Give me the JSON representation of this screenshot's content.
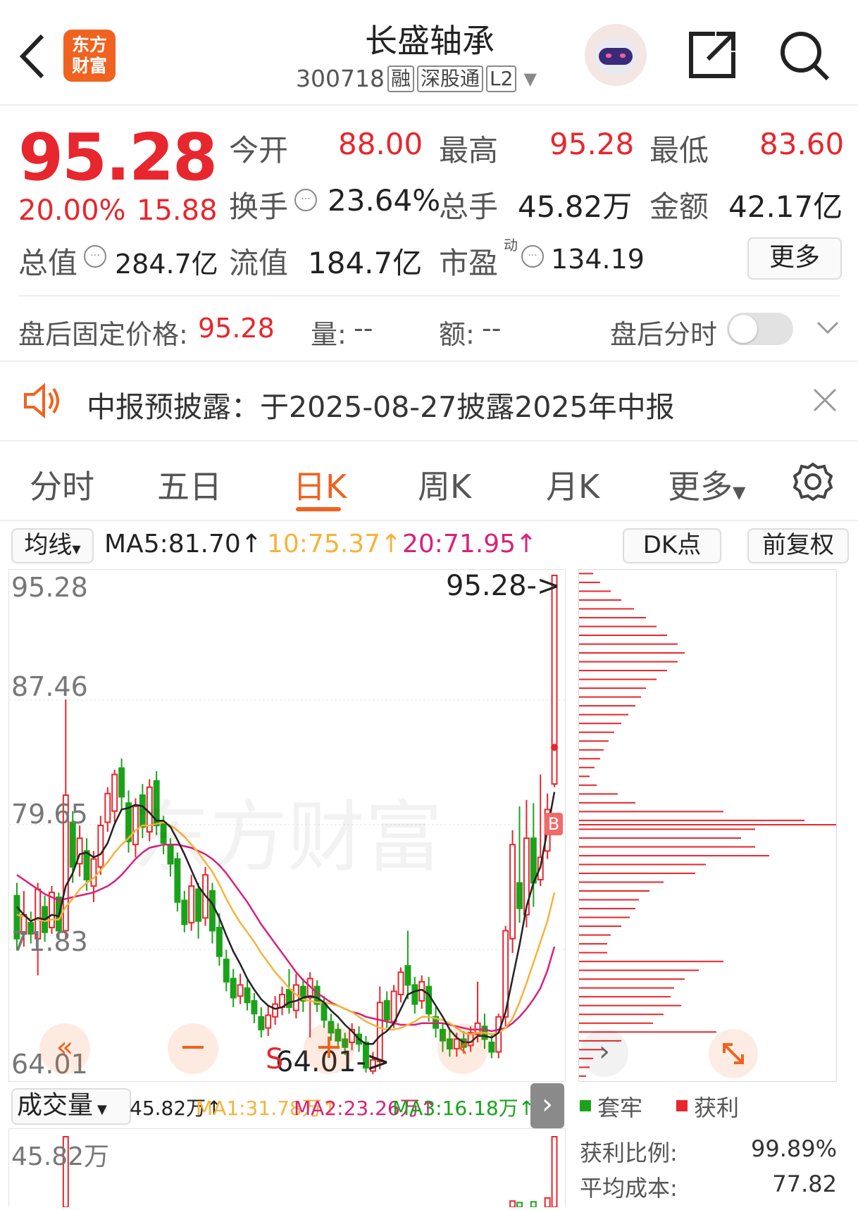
{
  "header": {
    "logo_text_1": "东方",
    "logo_text_2": "财富",
    "stock_name": "长盛轴承",
    "stock_code": "300718",
    "tags": [
      "融",
      "深股通",
      "L2"
    ]
  },
  "quote": {
    "price": "95.28",
    "change_pct": "20.00%",
    "change_amt": "15.88",
    "open_label": "今开",
    "open": "88.00",
    "high_label": "最高",
    "high": "95.28",
    "low_label": "最低",
    "low": "83.60",
    "turnover_label": "换手",
    "turnover": "23.64%",
    "volume_label": "总手",
    "volume": "45.82万",
    "amount_label": "金额",
    "amount": "42.17亿",
    "mktcap_label": "总值",
    "mktcap": "284.7亿",
    "float_label": "流值",
    "float": "184.7亿",
    "pe_label": "市盈",
    "pe_sup": "动",
    "pe": "134.19",
    "more_button": "更多"
  },
  "after_hours": {
    "price_label": "盘后固定价格:",
    "price": "95.28",
    "vol_label": "量:",
    "vol": "--",
    "amt_label": "额:",
    "amt": "--",
    "toggle_label": "盘后分时",
    "toggle_on": false
  },
  "notice": {
    "text": "中报预披露：于2025-08-27披露2025年中报"
  },
  "tabs": [
    "分时",
    "五日",
    "日K",
    "周K",
    "月K",
    "更多"
  ],
  "active_tab": "日K",
  "ma_bar": {
    "selector": "均线",
    "ma5": "MA5:81.70↑",
    "ma10": "10:75.37↑",
    "ma20": "20:71.95↑",
    "dk_button": "DK点",
    "adjust_button": "前复权"
  },
  "price_axis": [
    "95.28",
    "87.46",
    "79.65",
    "71.83",
    "64.01"
  ],
  "max_marker": "95.28->",
  "min_marker": "64.01->",
  "watermark": "东方财富",
  "volume_bar": {
    "selector": "成交量",
    "vol": "45.82万↑",
    "ma1": "MA1:31.78万↑",
    "ma2": "MA2:23.26万↑",
    "ma3": "MA3:16.18万↑",
    "axis_top": "45.82万"
  },
  "chip": {
    "legend_trapped": "套牢",
    "legend_profit": "获利",
    "profit_ratio_label": "获利比例:",
    "profit_ratio": "99.89%",
    "avg_cost_label": "平均成本:",
    "avg_cost": "77.82"
  },
  "colors": {
    "up": "#e8262d",
    "down": "#1aa31a",
    "ma5": "#222222",
    "ma10": "#f5b33a",
    "ma20": "#d8217a",
    "accent": "#f0621f"
  },
  "chart_data": {
    "type": "candlestick",
    "ylim": [
      64.01,
      95.28
    ],
    "candles": [
      {
        "o": 75.2,
        "c": 72.5,
        "h": 76.0,
        "l": 71.8
      },
      {
        "o": 72.8,
        "c": 74.0,
        "h": 75.5,
        "l": 72.0
      },
      {
        "o": 73.5,
        "c": 72.8,
        "h": 74.2,
        "l": 72.2
      },
      {
        "o": 72.5,
        "c": 75.6,
        "h": 76.0,
        "l": 70.2
      },
      {
        "o": 74.5,
        "c": 72.9,
        "h": 75.2,
        "l": 72.3
      },
      {
        "o": 73.2,
        "c": 75.4,
        "h": 75.8,
        "l": 72.8
      },
      {
        "o": 75.1,
        "c": 73.0,
        "h": 75.4,
        "l": 72.5
      },
      {
        "o": 73.0,
        "c": 81.5,
        "h": 87.5,
        "l": 72.5
      },
      {
        "o": 79.8,
        "c": 77.0,
        "h": 80.5,
        "l": 76.0
      },
      {
        "o": 77.2,
        "c": 78.8,
        "h": 79.6,
        "l": 76.4
      },
      {
        "o": 78.0,
        "c": 76.2,
        "h": 78.8,
        "l": 75.5
      },
      {
        "o": 75.8,
        "c": 77.5,
        "h": 78.0,
        "l": 74.8
      },
      {
        "o": 77.0,
        "c": 79.6,
        "h": 80.2,
        "l": 76.5
      },
      {
        "o": 79.8,
        "c": 81.6,
        "h": 82.0,
        "l": 79.2
      },
      {
        "o": 80.5,
        "c": 82.8,
        "h": 83.1,
        "l": 79.8
      },
      {
        "o": 83.2,
        "c": 81.4,
        "h": 83.8,
        "l": 80.6
      },
      {
        "o": 81.0,
        "c": 78.6,
        "h": 81.8,
        "l": 77.9
      },
      {
        "o": 78.4,
        "c": 80.8,
        "h": 81.3,
        "l": 77.6
      },
      {
        "o": 81.5,
        "c": 79.5,
        "h": 82.2,
        "l": 78.8
      },
      {
        "o": 79.2,
        "c": 82.0,
        "h": 82.5,
        "l": 78.6
      },
      {
        "o": 82.4,
        "c": 79.6,
        "h": 83.0,
        "l": 79.0
      },
      {
        "o": 79.8,
        "c": 78.5,
        "h": 80.2,
        "l": 77.8
      },
      {
        "o": 78.3,
        "c": 77.2,
        "h": 78.8,
        "l": 76.4
      },
      {
        "o": 77.5,
        "c": 74.8,
        "h": 77.9,
        "l": 74.2
      },
      {
        "o": 74.9,
        "c": 73.4,
        "h": 75.5,
        "l": 72.9
      },
      {
        "o": 73.5,
        "c": 75.8,
        "h": 76.5,
        "l": 73.0
      },
      {
        "o": 75.6,
        "c": 73.6,
        "h": 76.0,
        "l": 72.5
      },
      {
        "o": 73.8,
        "c": 76.5,
        "h": 77.0,
        "l": 73.3
      },
      {
        "o": 75.5,
        "c": 73.0,
        "h": 76.0,
        "l": 72.2
      },
      {
        "o": 73.2,
        "c": 71.4,
        "h": 74.1,
        "l": 70.8
      },
      {
        "o": 71.2,
        "c": 69.8,
        "h": 71.8,
        "l": 69.2
      },
      {
        "o": 70.0,
        "c": 68.8,
        "h": 70.6,
        "l": 68.2
      },
      {
        "o": 68.9,
        "c": 69.6,
        "h": 70.3,
        "l": 68.4
      },
      {
        "o": 69.4,
        "c": 68.5,
        "h": 69.9,
        "l": 68.0
      },
      {
        "o": 68.6,
        "c": 67.8,
        "h": 69.1,
        "l": 67.2
      },
      {
        "o": 67.6,
        "c": 66.8,
        "h": 68.2,
        "l": 66.3
      },
      {
        "o": 66.9,
        "c": 67.7,
        "h": 68.3,
        "l": 66.4
      },
      {
        "o": 67.6,
        "c": 68.4,
        "h": 68.9,
        "l": 67.1
      },
      {
        "o": 68.2,
        "c": 69.0,
        "h": 69.5,
        "l": 67.7
      },
      {
        "o": 69.3,
        "c": 68.2,
        "h": 70.6,
        "l": 67.8
      },
      {
        "o": 68.0,
        "c": 69.6,
        "h": 70.3,
        "l": 67.5
      },
      {
        "o": 69.5,
        "c": 68.6,
        "h": 70.0,
        "l": 67.9
      },
      {
        "o": 68.8,
        "c": 70.0,
        "h": 70.4,
        "l": 66.3
      },
      {
        "o": 69.5,
        "c": 68.4,
        "h": 69.9,
        "l": 67.9
      },
      {
        "o": 68.5,
        "c": 67.4,
        "h": 68.9,
        "l": 66.9
      },
      {
        "o": 67.3,
        "c": 66.6,
        "h": 67.8,
        "l": 66.1
      },
      {
        "o": 66.8,
        "c": 66.1,
        "h": 67.2,
        "l": 65.7
      },
      {
        "o": 66.2,
        "c": 65.7,
        "h": 66.6,
        "l": 65.2
      },
      {
        "o": 66.0,
        "c": 66.8,
        "h": 67.2,
        "l": 65.5
      },
      {
        "o": 66.5,
        "c": 65.9,
        "h": 67.0,
        "l": 65.4
      },
      {
        "o": 66.0,
        "c": 64.4,
        "h": 66.4,
        "l": 64.1
      },
      {
        "o": 64.2,
        "c": 64.9,
        "h": 65.4,
        "l": 64.0
      },
      {
        "o": 64.8,
        "c": 68.5,
        "h": 69.5,
        "l": 64.3
      },
      {
        "o": 68.6,
        "c": 67.4,
        "h": 69.2,
        "l": 66.9
      },
      {
        "o": 67.3,
        "c": 69.2,
        "h": 69.6,
        "l": 66.9
      },
      {
        "o": 69.0,
        "c": 70.4,
        "h": 70.7,
        "l": 68.5
      },
      {
        "o": 70.8,
        "c": 69.6,
        "h": 73.0,
        "l": 68.7
      },
      {
        "o": 69.6,
        "c": 68.4,
        "h": 70.1,
        "l": 67.8
      },
      {
        "o": 68.6,
        "c": 69.8,
        "h": 70.2,
        "l": 68.1
      },
      {
        "o": 69.5,
        "c": 67.8,
        "h": 70.1,
        "l": 67.3
      },
      {
        "o": 67.6,
        "c": 66.9,
        "h": 68.2,
        "l": 66.3
      },
      {
        "o": 66.8,
        "c": 66.1,
        "h": 67.2,
        "l": 65.4
      },
      {
        "o": 66.2,
        "c": 65.6,
        "h": 66.8,
        "l": 65.1
      },
      {
        "o": 65.6,
        "c": 66.2,
        "h": 66.6,
        "l": 65.1
      },
      {
        "o": 66.2,
        "c": 65.7,
        "h": 66.7,
        "l": 65.3
      },
      {
        "o": 65.8,
        "c": 66.6,
        "h": 67.0,
        "l": 65.4
      },
      {
        "o": 66.5,
        "c": 67.2,
        "h": 69.8,
        "l": 66.0
      },
      {
        "o": 67.0,
        "c": 66.2,
        "h": 67.8,
        "l": 65.6
      },
      {
        "o": 66.0,
        "c": 65.4,
        "h": 66.5,
        "l": 65.0
      },
      {
        "o": 65.4,
        "c": 67.6,
        "h": 67.8,
        "l": 65.0
      },
      {
        "o": 67.6,
        "c": 73.0,
        "h": 73.3,
        "l": 67.0
      },
      {
        "o": 72.5,
        "c": 78.4,
        "h": 79.3,
        "l": 71.6
      },
      {
        "o": 76.0,
        "c": 74.4,
        "h": 80.8,
        "l": 73.5
      },
      {
        "o": 74.0,
        "c": 78.8,
        "h": 81.2,
        "l": 73.2
      },
      {
        "o": 78.8,
        "c": 76.0,
        "h": 81.0,
        "l": 74.5
      },
      {
        "o": 76.2,
        "c": 77.6,
        "h": 82.8,
        "l": 75.8
      },
      {
        "o": 78.0,
        "c": 80.6,
        "h": 81.6,
        "l": 77.5
      },
      {
        "o": 82.2,
        "c": 95.28,
        "h": 95.28,
        "l": 82.0
      }
    ],
    "ma5": [
      74.5,
      74.0,
      73.6,
      73.8,
      73.7,
      74.0,
      73.9,
      75.8,
      76.6,
      77.8,
      77.9,
      77.6,
      77.8,
      78.5,
      79.7,
      80.6,
      80.7,
      80.9,
      80.8,
      80.4,
      79.9,
      79.9,
      79.5,
      78.7,
      77.8,
      76.8,
      75.8,
      75.2,
      74.7,
      73.8,
      72.7,
      71.7,
      70.9,
      70.0,
      69.3,
      68.7,
      68.3,
      68.1,
      68.2,
      68.5,
      68.6,
      68.8,
      68.9,
      68.8,
      68.5,
      68.0,
      67.6,
      67.1,
      66.7,
      66.2,
      65.9,
      65.9,
      66.4,
      66.7,
      67.2,
      68.1,
      69.0,
      69.2,
      69.3,
      69.0,
      68.3,
      67.6,
      66.8,
      66.3,
      66.0,
      66.0,
      66.4,
      66.4,
      66.3,
      66.6,
      67.9,
      70.0,
      72.1,
      74.5,
      76.0,
      77.0,
      79.3,
      81.7
    ],
    "ma10": [
      74.0,
      73.9,
      73.7,
      73.7,
      73.6,
      73.7,
      73.7,
      74.5,
      75.0,
      75.6,
      76.0,
      76.3,
      76.8,
      77.3,
      77.9,
      78.4,
      78.8,
      79.3,
      79.6,
      79.6,
      79.7,
      79.8,
      79.6,
      79.3,
      78.9,
      78.4,
      77.9,
      77.3,
      76.7,
      75.9,
      75.0,
      74.2,
      73.5,
      72.9,
      72.3,
      71.6,
      71.0,
      70.4,
      69.9,
      69.4,
      69.0,
      68.7,
      68.6,
      68.5,
      68.5,
      68.4,
      68.3,
      68.1,
      67.9,
      67.6,
      67.3,
      67.1,
      66.9,
      66.8,
      66.8,
      66.9,
      67.1,
      67.3,
      67.6,
      67.6,
      67.5,
      67.4,
      67.2,
      66.9,
      66.6,
      66.5,
      66.6,
      66.6,
      66.5,
      66.6,
      66.9,
      67.5,
      68.5,
      69.7,
      71.0,
      72.3,
      73.6,
      75.4
    ],
    "ma20": [
      76.5,
      76.2,
      75.9,
      75.6,
      75.3,
      75.1,
      74.9,
      75.0,
      75.1,
      75.2,
      75.3,
      75.4,
      75.6,
      75.8,
      76.1,
      76.5,
      77.0,
      77.5,
      77.9,
      78.2,
      78.3,
      78.4,
      78.4,
      78.4,
      78.3,
      78.2,
      78.0,
      77.8,
      77.5,
      77.1,
      76.6,
      76.0,
      75.4,
      74.8,
      74.1,
      73.4,
      72.8,
      72.2,
      71.6,
      71.0,
      70.4,
      69.9,
      69.5,
      69.1,
      68.8,
      68.5,
      68.3,
      68.1,
      67.9,
      67.8,
      67.6,
      67.5,
      67.4,
      67.3,
      67.2,
      67.1,
      67.1,
      67.1,
      67.2,
      67.2,
      67.2,
      67.2,
      67.1,
      67.0,
      66.9,
      66.8,
      66.8,
      66.8,
      66.7,
      66.8,
      66.9,
      67.2,
      67.6,
      68.1,
      68.7,
      69.4,
      70.5,
      72.0
    ],
    "volume_ylim": [
      0,
      45.82
    ]
  }
}
